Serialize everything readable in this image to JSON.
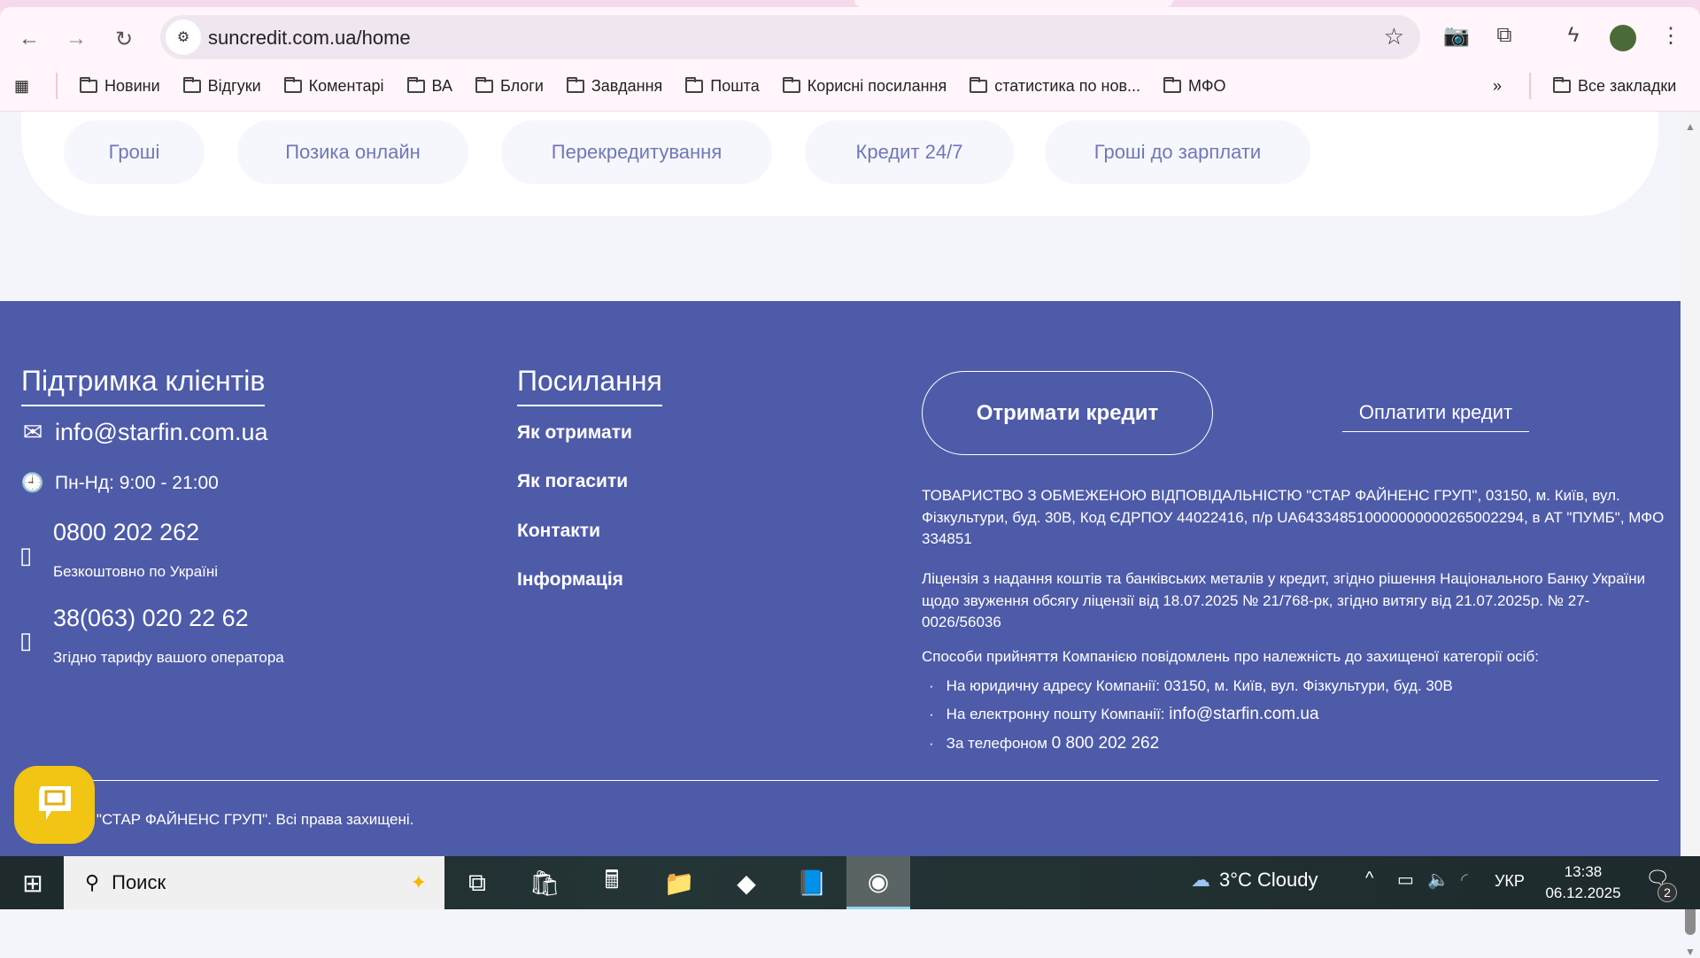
{
  "browser": {
    "url": "suncredit.com.ua/home",
    "bookmarks": [
      "Новини",
      "Відгуки",
      "Коментарі",
      "ВА",
      "Блоги",
      "Завдання",
      "Пошта",
      "Корисні посилання",
      "статистика по нов...",
      "МФО"
    ],
    "overflow": "»",
    "all_bookmarks": "Все закладки"
  },
  "pills": [
    "Гроші",
    "Позика онлайн",
    "Перекредитування",
    "Кредит 24/7",
    "Гроші до зарплати"
  ],
  "footer": {
    "support": {
      "title": "Підтримка клієнтів",
      "email": "info@starfin.com.ua",
      "hours": "Пн-Нд: 9:00 - 21:00",
      "phone1": "0800 202 262",
      "phone1_note": "Безкоштовно по Україні",
      "phone2": "38(063) 020 22 62",
      "phone2_note": "Згідно тарифу вашого оператора"
    },
    "links": {
      "title": "Посилання",
      "items": [
        "Як отримати",
        "Як погасити",
        "Контакти",
        "Інформація"
      ]
    },
    "get_credit": "Отримати кредит",
    "pay_credit": "Оплатити кредит",
    "company": "ТОВАРИСТВО З ОБМЕЖЕНОЮ ВІДПОВІДАЛЬНІСТЮ \"СТАР ФАЙНЕНС ГРУП\", 03150, м. Київ, вул. Фізкультури, буд. 30В, Код ЄДРПОУ 44022416, п/р UA643348510000000000265002294, в АТ \"ПУМБ\", МФО 334851",
    "license": "Ліцензія з надання коштів та банківських металів у кредит, згідно рішення Національного Банку України щодо звуження обсягу ліцензії від 18.07.2025 № 21/768-рк, згідно витягу від 21.07.2025р. № 27-0026/56036",
    "methods_title": "Способи прийняття Компанією повідомлень про належність до захищеної категорії осіб:",
    "methods": [
      {
        "label": "На юридичну адресу Компанії: 03150, м. Київ, вул. Фізкультури, буд. 30В",
        "value": ""
      },
      {
        "label": "На електронну пошту Компанії: ",
        "value": "info@starfin.com.ua"
      },
      {
        "label": "За телефоном ",
        "value": "0 800 202 262"
      }
    ],
    "copyright": "ТОВ \"СТАР ФАЙНЕНС ГРУП\". Всі права захищені."
  },
  "taskbar": {
    "search": "Поиск",
    "weather": "3°C  Cloudy",
    "lang": "УКР",
    "time": "13:38",
    "date": "06.12.2025",
    "notifications": "2"
  },
  "colors": {
    "footer": "#4e5ba8",
    "pill_text": "#6f78b8",
    "chat": "#f2c414"
  }
}
